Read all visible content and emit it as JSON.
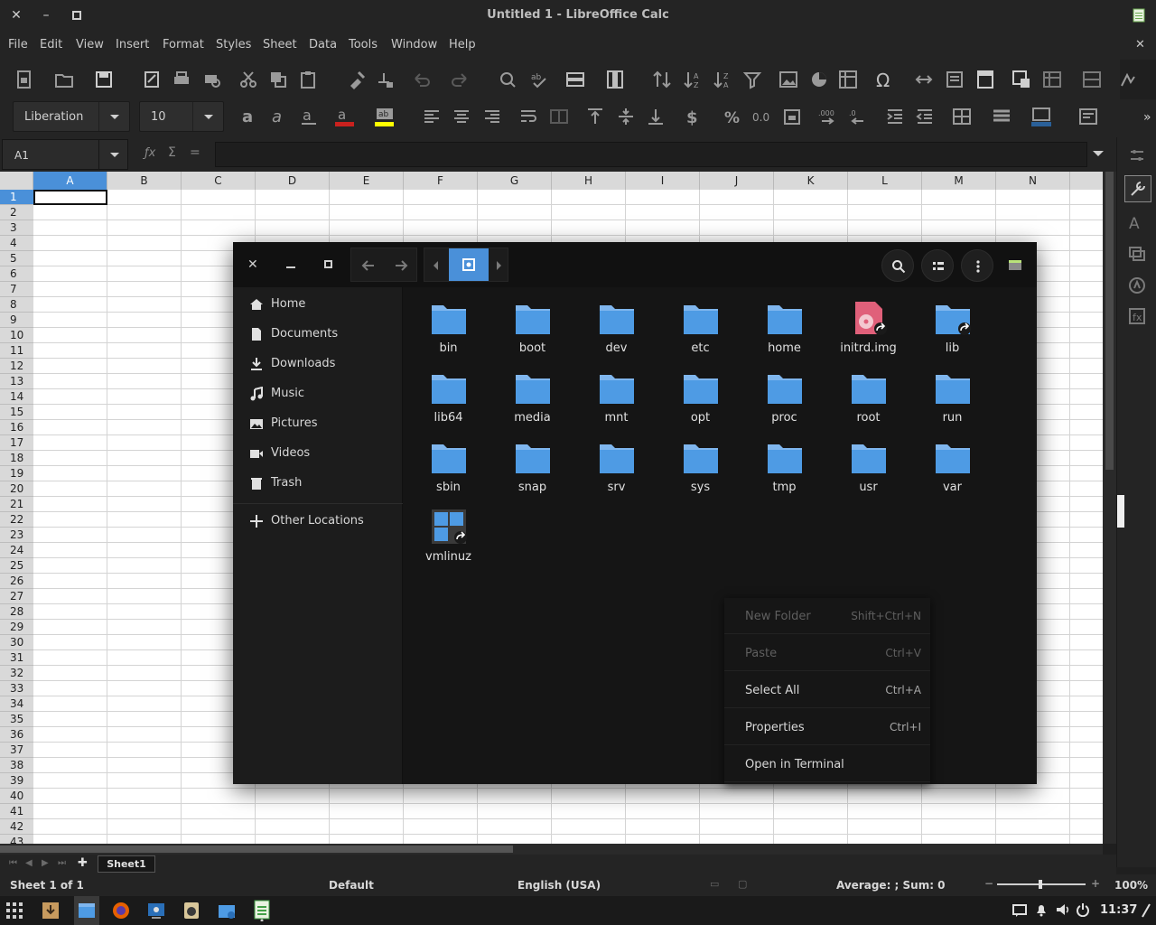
{
  "window": {
    "title": "Untitled 1 - LibreOffice Calc"
  },
  "menubar": [
    "File",
    "Edit",
    "View",
    "Insert",
    "Format",
    "Styles",
    "Sheet",
    "Data",
    "Tools",
    "Window",
    "Help"
  ],
  "formatting": {
    "font_name": "Liberation",
    "font_size": "10"
  },
  "formula_bar": {
    "cell_ref": "A1",
    "formula": ""
  },
  "sheet": {
    "columns": [
      "A",
      "B",
      "C",
      "D",
      "E",
      "F",
      "G",
      "H",
      "I",
      "J",
      "K",
      "L",
      "M",
      "N"
    ],
    "rows": [
      "1",
      "2",
      "3",
      "4",
      "5",
      "6",
      "7",
      "8",
      "9",
      "10",
      "11",
      "12",
      "13",
      "14",
      "15",
      "16",
      "17",
      "18",
      "19",
      "20",
      "21",
      "22",
      "23",
      "24",
      "25",
      "26",
      "27",
      "28",
      "29",
      "30",
      "31",
      "32",
      "33",
      "34",
      "35",
      "36",
      "37",
      "38",
      "39",
      "40",
      "41",
      "42",
      "43"
    ],
    "selected_cell": "A1",
    "tabs": [
      "Sheet1"
    ]
  },
  "statusbar": {
    "sheet_info": "Sheet 1 of 1",
    "page_style": "Default",
    "language": "English (USA)",
    "summary": "Average: ; Sum: 0",
    "zoom": "100%"
  },
  "taskbar": {
    "clock": "11:37"
  },
  "file_manager": {
    "sidebar": [
      "Home",
      "Documents",
      "Downloads",
      "Music",
      "Pictures",
      "Videos",
      "Trash"
    ],
    "other_locations": "Other Locations",
    "files": [
      {
        "name": "bin",
        "type": "folder"
      },
      {
        "name": "boot",
        "type": "folder"
      },
      {
        "name": "dev",
        "type": "folder"
      },
      {
        "name": "etc",
        "type": "folder"
      },
      {
        "name": "home",
        "type": "folder"
      },
      {
        "name": "initrd.img",
        "type": "disk-image-link"
      },
      {
        "name": "lib",
        "type": "folder-link"
      },
      {
        "name": "lib64",
        "type": "folder"
      },
      {
        "name": "media",
        "type": "folder"
      },
      {
        "name": "mnt",
        "type": "folder"
      },
      {
        "name": "opt",
        "type": "folder"
      },
      {
        "name": "proc",
        "type": "folder"
      },
      {
        "name": "root",
        "type": "folder"
      },
      {
        "name": "run",
        "type": "folder"
      },
      {
        "name": "sbin",
        "type": "folder"
      },
      {
        "name": "snap",
        "type": "folder"
      },
      {
        "name": "srv",
        "type": "folder"
      },
      {
        "name": "sys",
        "type": "folder"
      },
      {
        "name": "tmp",
        "type": "folder"
      },
      {
        "name": "usr",
        "type": "folder"
      },
      {
        "name": "var",
        "type": "folder"
      },
      {
        "name": "vmlinuz",
        "type": "binary-link"
      }
    ]
  },
  "context_menu": [
    {
      "label": "New Folder",
      "shortcut": "Shift+Ctrl+N",
      "enabled": false
    },
    {
      "label": "Paste",
      "shortcut": "Ctrl+V",
      "enabled": false
    },
    {
      "label": "Select All",
      "shortcut": "Ctrl+A",
      "enabled": true
    },
    {
      "label": "Properties",
      "shortcut": "Ctrl+I",
      "enabled": true
    },
    {
      "label": "Open in Terminal",
      "shortcut": "",
      "enabled": true
    }
  ],
  "colors": {
    "accent": "#4a90d9",
    "folder": "#4e9be4",
    "folder_tab": "#7fb6ee",
    "disk": "#e0607a"
  }
}
